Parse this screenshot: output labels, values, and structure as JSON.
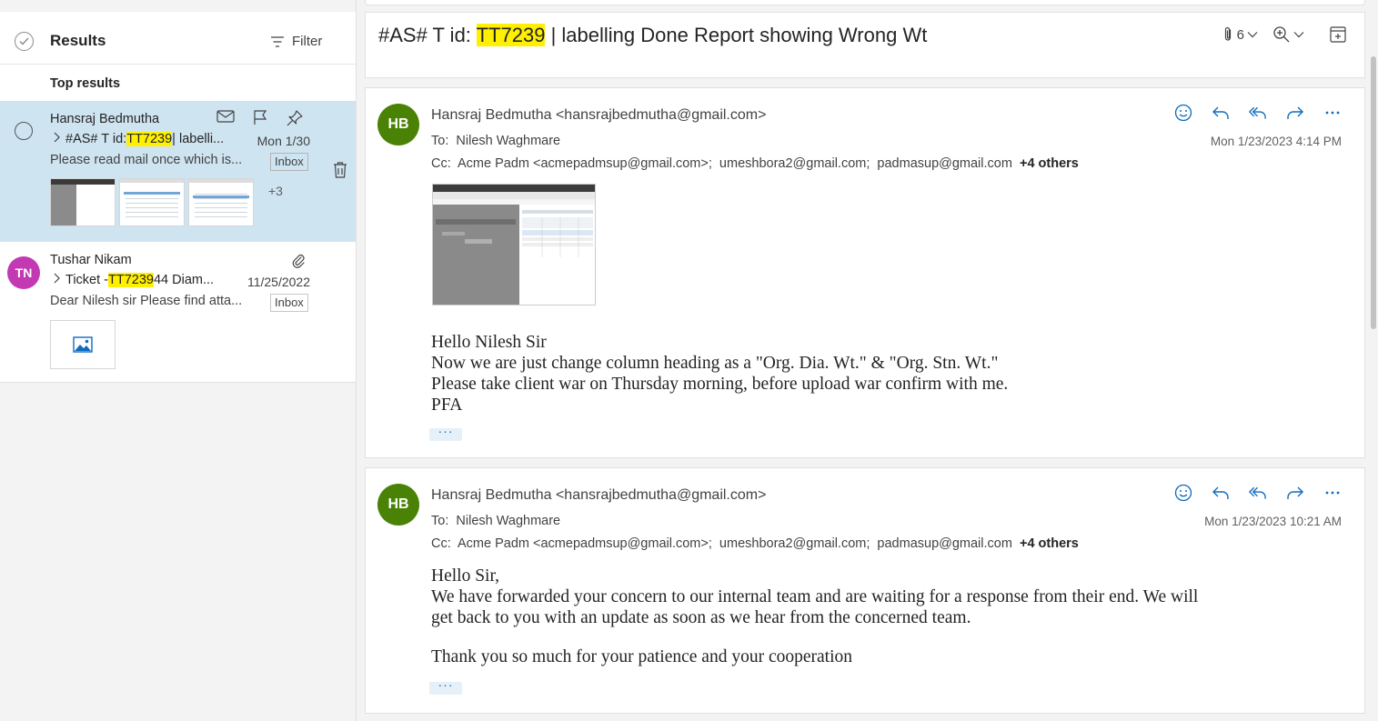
{
  "results_pane": {
    "title": "Results",
    "filter_label": "Filter",
    "section_label": "Top results",
    "items": [
      {
        "sender": "Hansraj Bedmutha",
        "subject_prefix": "#AS# T id: ",
        "subject_highlight": "TT7239",
        "subject_suffix": " | labelli...",
        "date": "Mon 1/30",
        "preview": "Please read mail once which is...",
        "folder": "Inbox",
        "more_attachments": "+3",
        "selected": true
      },
      {
        "sender": "Tushar Nikam",
        "avatar_initials": "TN",
        "subject_prefix": "Ticket - ",
        "subject_highlight": "TT7239",
        "subject_suffix": " 44 Diam...",
        "date": "11/25/2022",
        "preview": "Dear Nilesh sir Please find atta...",
        "folder": "Inbox",
        "selected": false
      }
    ]
  },
  "reading_pane": {
    "subject_prefix": "#AS# T id: ",
    "subject_highlight": "TT7239",
    "subject_suffix": " | labelling Done Report showing Wrong Wt",
    "attachment_count": "6",
    "messages": [
      {
        "avatar_initials": "HB",
        "from": "Hansraj Bedmutha <hansrajbedmutha@gmail.com>",
        "to_label": "To:",
        "to": "Nilesh Waghmare",
        "cc_label": "Cc:",
        "cc": "Acme Padm <acmepadmsup@gmail.com>;  umeshbora2@gmail.com;  padmasup@gmail.com",
        "cc_more": "+4 others",
        "sent": "Mon 1/23/2023 4:14 PM",
        "body_lines": [
          "Hello Nilesh Sir",
          "Now we are just change column heading as a \"Org. Dia. Wt.\" & \"Org. Stn. Wt.\"",
          "Please take client war on Thursday morning, before upload war confirm with me.",
          "PFA"
        ]
      },
      {
        "avatar_initials": "HB",
        "from": "Hansraj Bedmutha <hansrajbedmutha@gmail.com>",
        "to_label": "To:",
        "to": "Nilesh Waghmare",
        "cc_label": "Cc:",
        "cc": "Acme Padm <acmepadmsup@gmail.com>;  umeshbora2@gmail.com;  padmasup@gmail.com",
        "cc_more": "+4 others",
        "sent": "Mon 1/23/2023 10:21 AM",
        "body_lines": [
          "Hello Sir,",
          "We have forwarded your concern to our internal team and are waiting for a response from their end. We will",
          "get back to you with an update as soon as we hear from the concerned team.",
          "",
          "Thank you so much for your patience and your cooperation"
        ]
      }
    ],
    "more_label": "···"
  },
  "colors": {
    "selected_bg": "#cfe4f1",
    "highlight": "#ffef00",
    "accent": "#0f6cbd",
    "avatar_hb": "#498205",
    "avatar_tn": "#c239b3"
  }
}
